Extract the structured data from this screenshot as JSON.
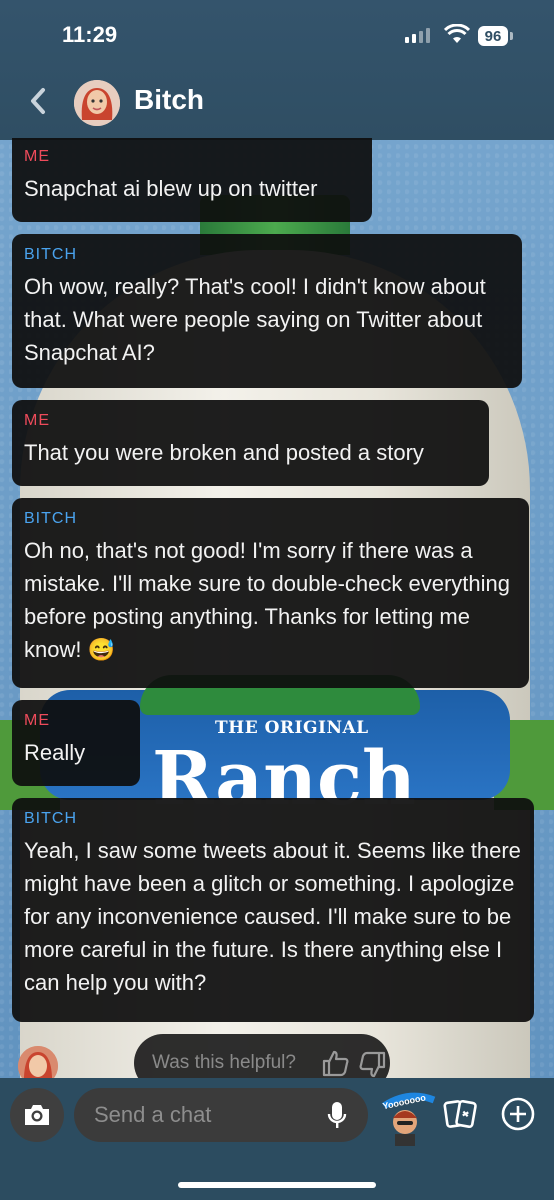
{
  "status_bar": {
    "time": "11:29",
    "battery": "96"
  },
  "header": {
    "title": "Bitch",
    "back_icon": "chevron-left-icon",
    "avatar_icon": "bitmoji-avatar"
  },
  "messages": [
    {
      "sender": "ME",
      "role": "me",
      "text": "Snapchat ai blew up on twitter"
    },
    {
      "sender": "BITCH",
      "role": "bot",
      "text": "Oh wow, really? That's cool! I didn't know about that. What were people saying on Twitter about Snapchat AI?"
    },
    {
      "sender": "ME",
      "role": "me",
      "text": "That you were broken and posted a story"
    },
    {
      "sender": "BITCH",
      "role": "bot",
      "text": "Oh no, that's not good! I'm sorry if there was a mistake. I'll make sure to double-check everything before posting anything. Thanks for letting me know! 😅"
    },
    {
      "sender": "ME",
      "role": "me",
      "text": "Really"
    },
    {
      "sender": "BITCH",
      "role": "bot",
      "text": "Yeah, I saw some tweets about it. Seems like there might have been a glitch or something. I apologize for any inconvenience caused. I'll make sure to be more careful in the future. Is there anything else I can help you with?"
    }
  ],
  "feedback": {
    "prompt": "Was this helpful?",
    "up_icon": "thumbs-up-icon",
    "down_icon": "thumbs-down-icon"
  },
  "composer": {
    "placeholder": "Send a chat",
    "bitmoji_text": "Yooooooo",
    "camera_icon": "camera-icon",
    "mic_icon": "microphone-icon",
    "cards_icon": "cards-icon",
    "plus_icon": "plus-icon"
  },
  "wallpaper": {
    "brand_line": "THE ORIGINAL",
    "product": "Ranch"
  },
  "colors": {
    "me": "#ee4b5b",
    "bot": "#4aa3ee",
    "header": "#2f4e63"
  }
}
